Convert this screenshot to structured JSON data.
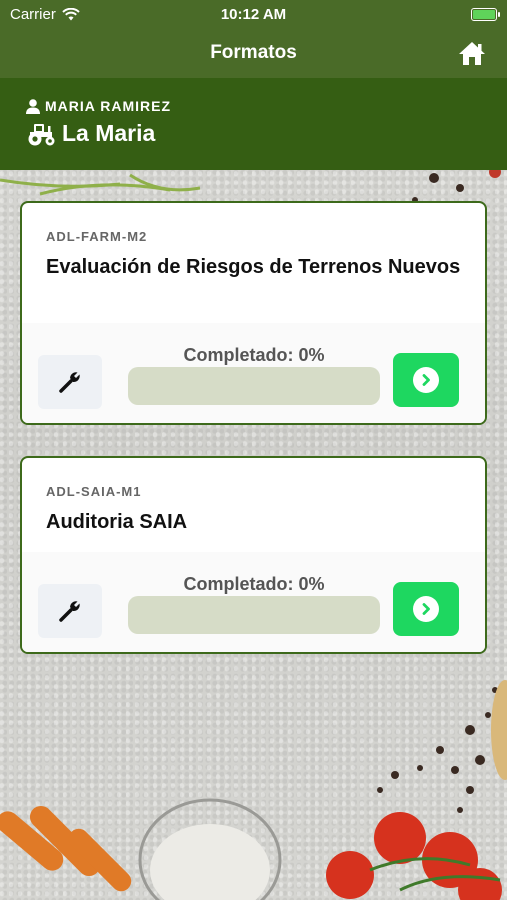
{
  "status_bar": {
    "carrier": "Carrier",
    "time": "10:12 AM"
  },
  "nav": {
    "title": "Formatos"
  },
  "header": {
    "user": "MARIA RAMIREZ",
    "farm": "La Maria"
  },
  "cards": [
    {
      "code": "ADL-FARM-M2",
      "title": "Evaluación de Riesgos de Terrenos Nuevos",
      "progress_label": "Completado: 0%",
      "progress": 0
    },
    {
      "code": "ADL-SAIA-M1",
      "title": "Auditoria SAIA",
      "progress_label": "Completado: 0%",
      "progress": 0
    }
  ],
  "colors": {
    "nav_bg": "#4a6b28",
    "header_bg": "#355e13",
    "accent_green": "#1ed760",
    "card_border": "#3d6a1b"
  }
}
